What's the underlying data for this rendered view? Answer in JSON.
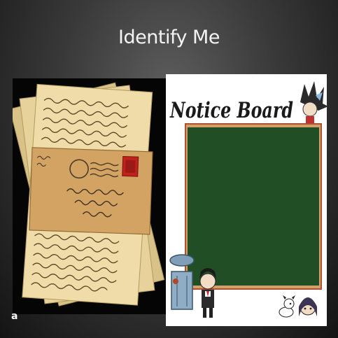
{
  "slide": {
    "title": "Identify Me"
  },
  "images": [
    {
      "label": "a",
      "subject": "envelope-with-letters",
      "envelope_address": "Mr D. Williams\nBellefont"
    },
    {
      "label": "",
      "subject": "notice-board",
      "heading": "Notice Board"
    }
  ],
  "colors": {
    "background": "#3a3a3a",
    "title_text": "#f4f4f4",
    "board_green": "#1e4a22",
    "board_frame": "#b05030",
    "paper": "#e8d39a",
    "stamp": "#c0221b"
  }
}
